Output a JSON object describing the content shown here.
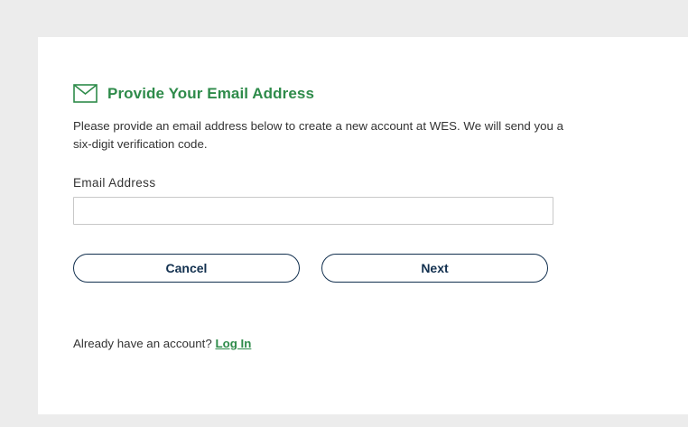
{
  "form": {
    "title": "Provide Your Email Address",
    "icon": "envelope-icon",
    "description": "Please provide an email address below to create a new account at WES. We will send you a six-digit verification code.",
    "email_label": "Email Address",
    "email_value": "",
    "email_placeholder": ""
  },
  "actions": {
    "cancel_label": "Cancel",
    "next_label": "Next"
  },
  "footer": {
    "prompt": "Already have an account?",
    "login_label": "Log In"
  },
  "colors": {
    "accent": "#2e8b4a",
    "button_border": "#12304f",
    "background": "#ececec"
  }
}
